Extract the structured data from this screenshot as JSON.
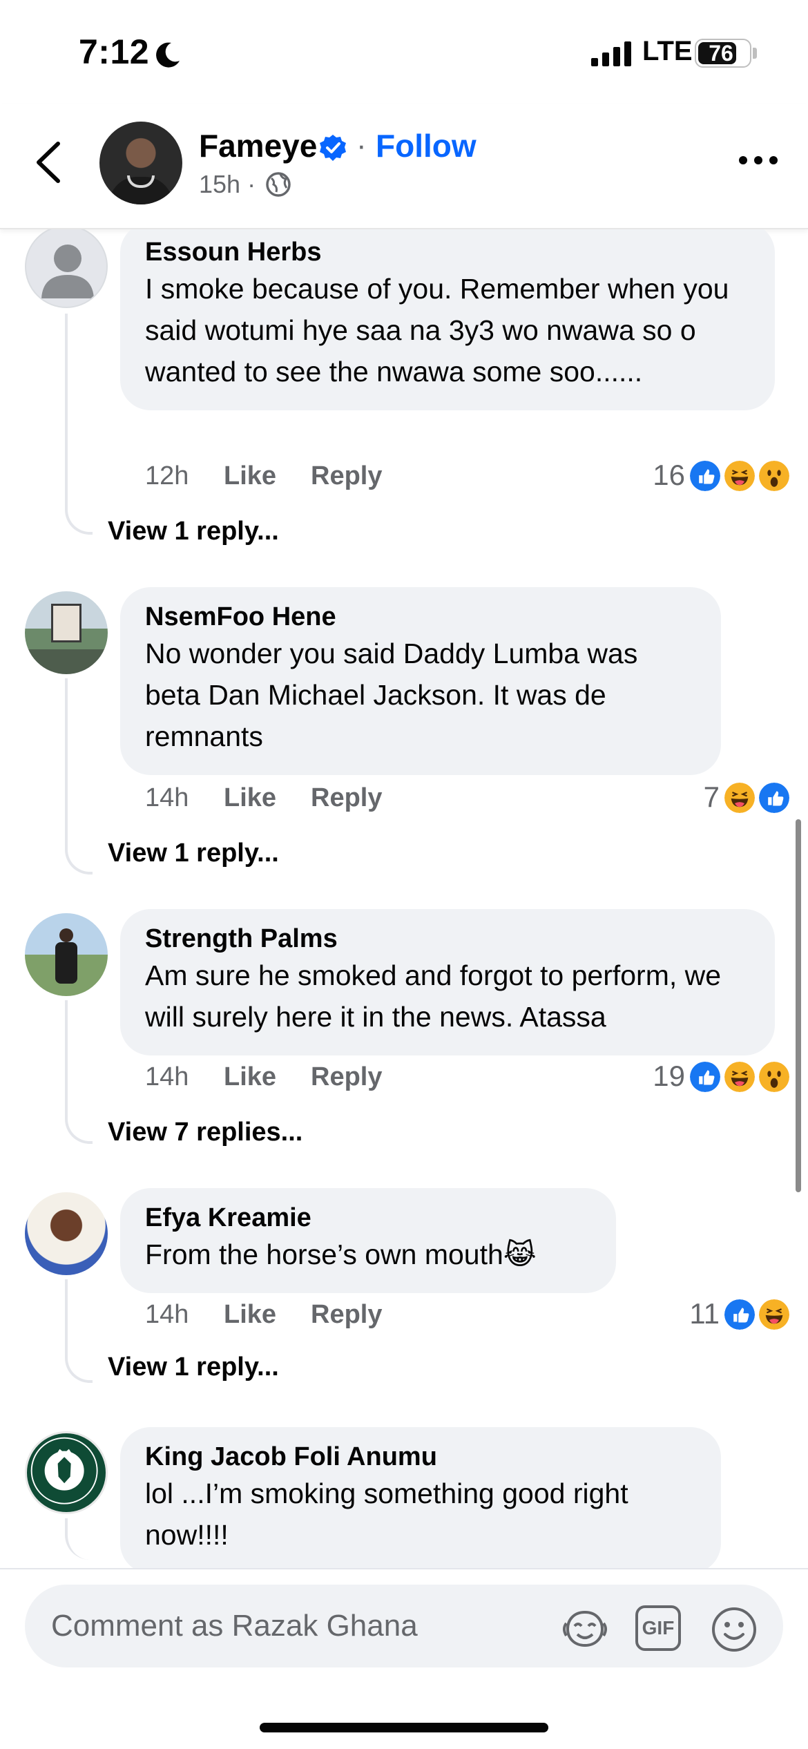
{
  "status_bar": {
    "time": "7:12",
    "network": "LTE",
    "battery": "76",
    "battery_level": 0.76
  },
  "header": {
    "author": "Fameye",
    "follow_label": "Follow",
    "separator": "·",
    "time": "15h ·"
  },
  "comments": [
    {
      "author": "Essoun Herbs",
      "text": "I smoke because of you. Remember when you said wotumi hye saa na 3y3 wo nwawa so o wanted to see the nwawa some soo......",
      "time": "12h",
      "like": "Like",
      "reply": "Reply",
      "reaction_count": "16",
      "reactions": [
        "like",
        "haha",
        "wow"
      ],
      "view_replies": "View 1 reply..."
    },
    {
      "author": "NsemFoo Hene",
      "text": "No wonder you said Daddy Lumba was beta Dan Michael Jackson. It was de remnants",
      "time": "14h",
      "like": "Like",
      "reply": "Reply",
      "reaction_count": "7",
      "reactions": [
        "haha",
        "like"
      ],
      "view_replies": "View 1 reply..."
    },
    {
      "author": "Strength Palms",
      "text": "Am sure he smoked and forgot to perform, we will surely here it in the news. Atassa",
      "time": "14h",
      "like": "Like",
      "reply": "Reply",
      "reaction_count": "19",
      "reactions": [
        "like",
        "haha",
        "wow"
      ],
      "view_replies": "View 7 replies..."
    },
    {
      "author": "Efya Kreamie",
      "text": "From the horse’s own mouth😹",
      "time": "14h",
      "like": "Like",
      "reply": "Reply",
      "reaction_count": "11",
      "reactions": [
        "like",
        "haha"
      ],
      "view_replies": "View 1 reply..."
    },
    {
      "author": "King Jacob Foli Anumu",
      "text": "lol ...I’m smoking something good right now!!!!",
      "avatar_text": "REAL MUSIC PEOPLE · LEGENDARY"
    }
  ],
  "composer": {
    "placeholder": "Comment as Razak Ghana",
    "gif_label": "GIF"
  },
  "colors": {
    "accent": "#0866ff",
    "bubble": "#f0f2f5",
    "muted": "#65676b",
    "haha": "#f7b125"
  }
}
